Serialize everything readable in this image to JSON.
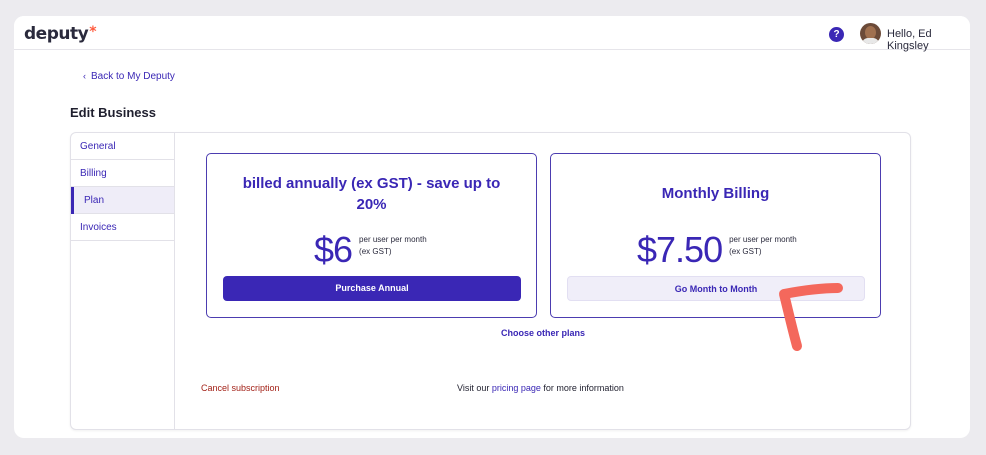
{
  "header": {
    "logo_text": "deputy",
    "logo_mark": "*",
    "help_label": "?",
    "greeting": "Hello, Ed Kingsley"
  },
  "back_link": "Back to My Deputy",
  "page_title": "Edit Business",
  "sidebar": {
    "items": [
      {
        "label": "General"
      },
      {
        "label": "Billing"
      },
      {
        "label": "Plan"
      },
      {
        "label": "Invoices"
      }
    ]
  },
  "plans": {
    "annual": {
      "title": "billed annually (ex GST) - save up to 20%",
      "price": "$6",
      "note_line1": "per user per month",
      "note_line2": "(ex GST)",
      "button": "Purchase Annual"
    },
    "monthly": {
      "title": "Monthly Billing",
      "price": "$7.50",
      "note_line1": "per user per month",
      "note_line2": "(ex GST)",
      "button": "Go Month to Month"
    }
  },
  "other_plans": "Choose other plans",
  "cancel": "Cancel subscription",
  "visit": {
    "prefix": "Visit our ",
    "link": "pricing page",
    "suffix": " for more information"
  },
  "colors": {
    "brand": "#3a27b5",
    "logo_accent": "#ff5a3d",
    "cancel": "#a32218",
    "annotation": "#f4685c"
  }
}
